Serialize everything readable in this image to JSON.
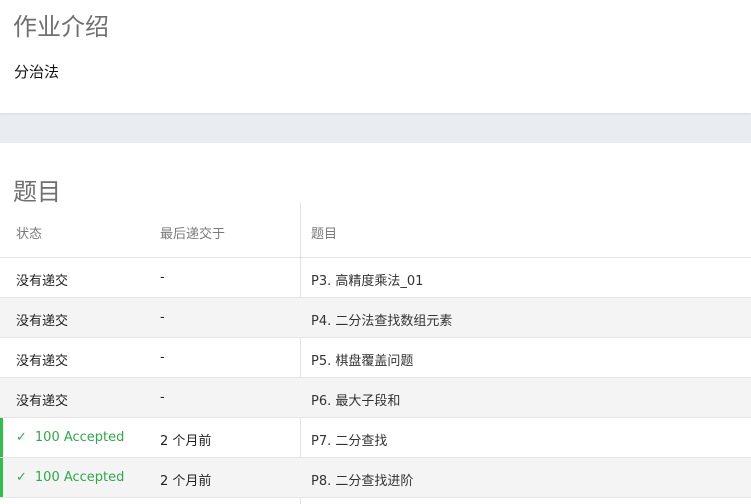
{
  "intro": {
    "title": "作业介绍",
    "text": "分治法"
  },
  "problems": {
    "title": "题目",
    "columns": {
      "status": "状态",
      "last_submit": "最后递交于",
      "problem": "题目"
    },
    "rows": [
      {
        "status": "没有递交",
        "time": "-",
        "problem": "P3. 高精度乘法_01",
        "accepted": false
      },
      {
        "status": "没有递交",
        "time": "-",
        "problem": "P4. 二分法查找数组元素",
        "accepted": false
      },
      {
        "status": "没有递交",
        "time": "-",
        "problem": "P5. 棋盘覆盖问题",
        "accepted": false
      },
      {
        "status": "没有递交",
        "time": "-",
        "problem": "P6. 最大子段和",
        "accepted": false
      },
      {
        "status": "100 Accepted",
        "time": "2 个月前",
        "problem": "P7. 二分查找",
        "accepted": true
      },
      {
        "status": "100 Accepted",
        "time": "2 个月前",
        "problem": "P8. 二分查找进阶",
        "accepted": true
      }
    ],
    "accepted_color": "#2fbf4b",
    "check_icon": "checkmark-icon"
  }
}
